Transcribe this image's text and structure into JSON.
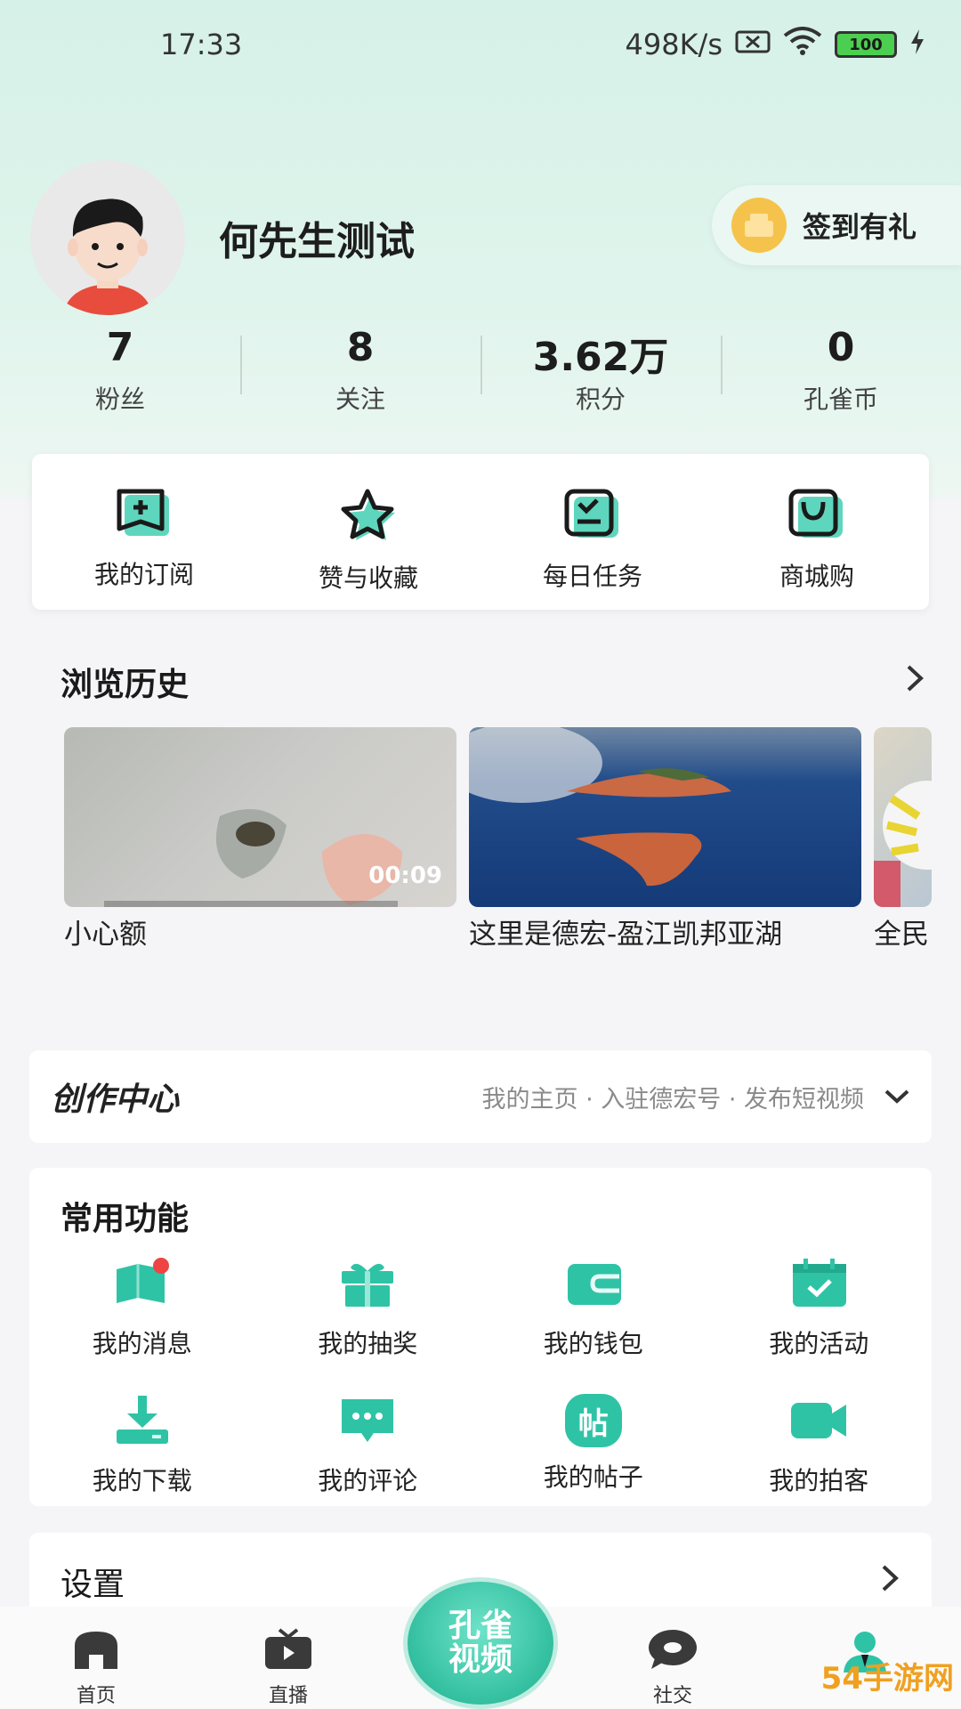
{
  "status_bar": {
    "time": "17:33",
    "speed": "498K/s",
    "battery": "100"
  },
  "profile": {
    "username": "何先生测试",
    "checkin_label": "签到有礼"
  },
  "stats": [
    {
      "value": "7",
      "label": "粉丝"
    },
    {
      "value": "8",
      "label": "关注"
    },
    {
      "value": "3.62万",
      "label": "积分"
    },
    {
      "value": "0",
      "label": "孔雀币"
    }
  ],
  "shortcuts": [
    {
      "label": "我的订阅",
      "icon": "subscribe-icon"
    },
    {
      "label": "赞与收藏",
      "icon": "star-icon"
    },
    {
      "label": "每日任务",
      "icon": "task-icon"
    },
    {
      "label": "商城购",
      "icon": "shopping-bag-icon"
    }
  ],
  "history": {
    "title": "浏览历史",
    "items": [
      {
        "title": "小心额",
        "duration": "00:09"
      },
      {
        "title": "这里是德宏-盈江凯邦亚湖",
        "duration": ""
      },
      {
        "title": "全民",
        "duration": ""
      }
    ]
  },
  "creator": {
    "logo": "创作中心",
    "links": "我的主页 · 入驻德宏号 · 发布短视频"
  },
  "functions": {
    "title": "常用功能",
    "items": [
      {
        "label": "我的消息",
        "icon": "message-icon"
      },
      {
        "label": "我的抽奖",
        "icon": "gift-icon"
      },
      {
        "label": "我的钱包",
        "icon": "wallet-icon"
      },
      {
        "label": "我的活动",
        "icon": "calendar-icon"
      },
      {
        "label": "我的下载",
        "icon": "download-icon"
      },
      {
        "label": "我的评论",
        "icon": "comment-icon"
      },
      {
        "label": "我的帖子",
        "icon": "post-icon",
        "glyph": "帖"
      },
      {
        "label": "我的拍客",
        "icon": "camera-icon"
      }
    ]
  },
  "settings": {
    "label": "设置"
  },
  "bottom_nav": [
    {
      "label": "首页",
      "icon": "home-icon"
    },
    {
      "label": "直播",
      "icon": "live-tv-icon"
    },
    {
      "label": "",
      "icon": "center-logo"
    },
    {
      "label": "社交",
      "icon": "chat-bubble-icon"
    },
    {
      "label": "",
      "icon": "profile-icon"
    }
  ],
  "center_logo": {
    "line1": "孔雀",
    "line2": "视频"
  },
  "watermark": "54手游网",
  "colors": {
    "accent": "#2fc3a6",
    "badge": "#ee4444",
    "background": "#f5f5f7"
  }
}
